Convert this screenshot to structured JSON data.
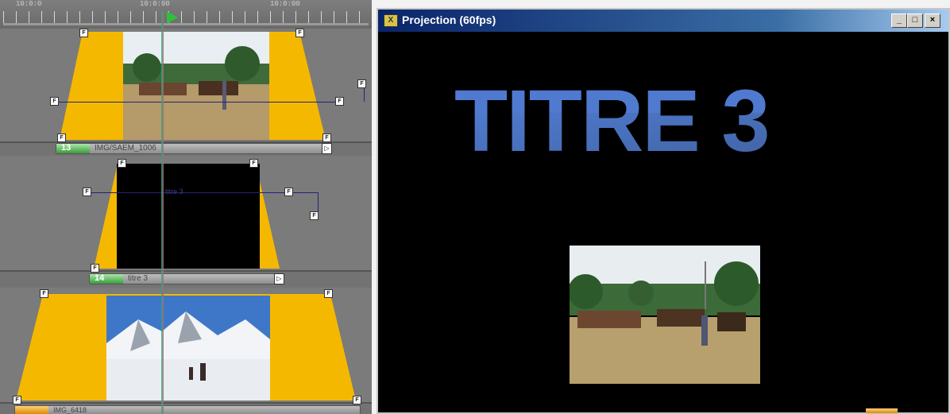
{
  "timeline": {
    "ruler_labels": [
      "10:0:0",
      "10:0:00",
      "10:0:00"
    ],
    "clips": [
      {
        "number": "13",
        "name": "IMG/SAEM_1006"
      },
      {
        "number": "14",
        "name": "titre 3"
      },
      {
        "number": "",
        "name": "IMG_6418"
      }
    ],
    "title_track_label": "titre 3"
  },
  "projection": {
    "window_title": "Projection (60fps)",
    "icon_label": "X",
    "title_text": "TITRE 3",
    "buttons": {
      "minimize": "_",
      "maximize": "□",
      "close": "×"
    }
  },
  "colors": {
    "accent_yellow": "#f5b800",
    "title_blue": "#4f7ad0",
    "window_title_bar": "#0a246a"
  }
}
